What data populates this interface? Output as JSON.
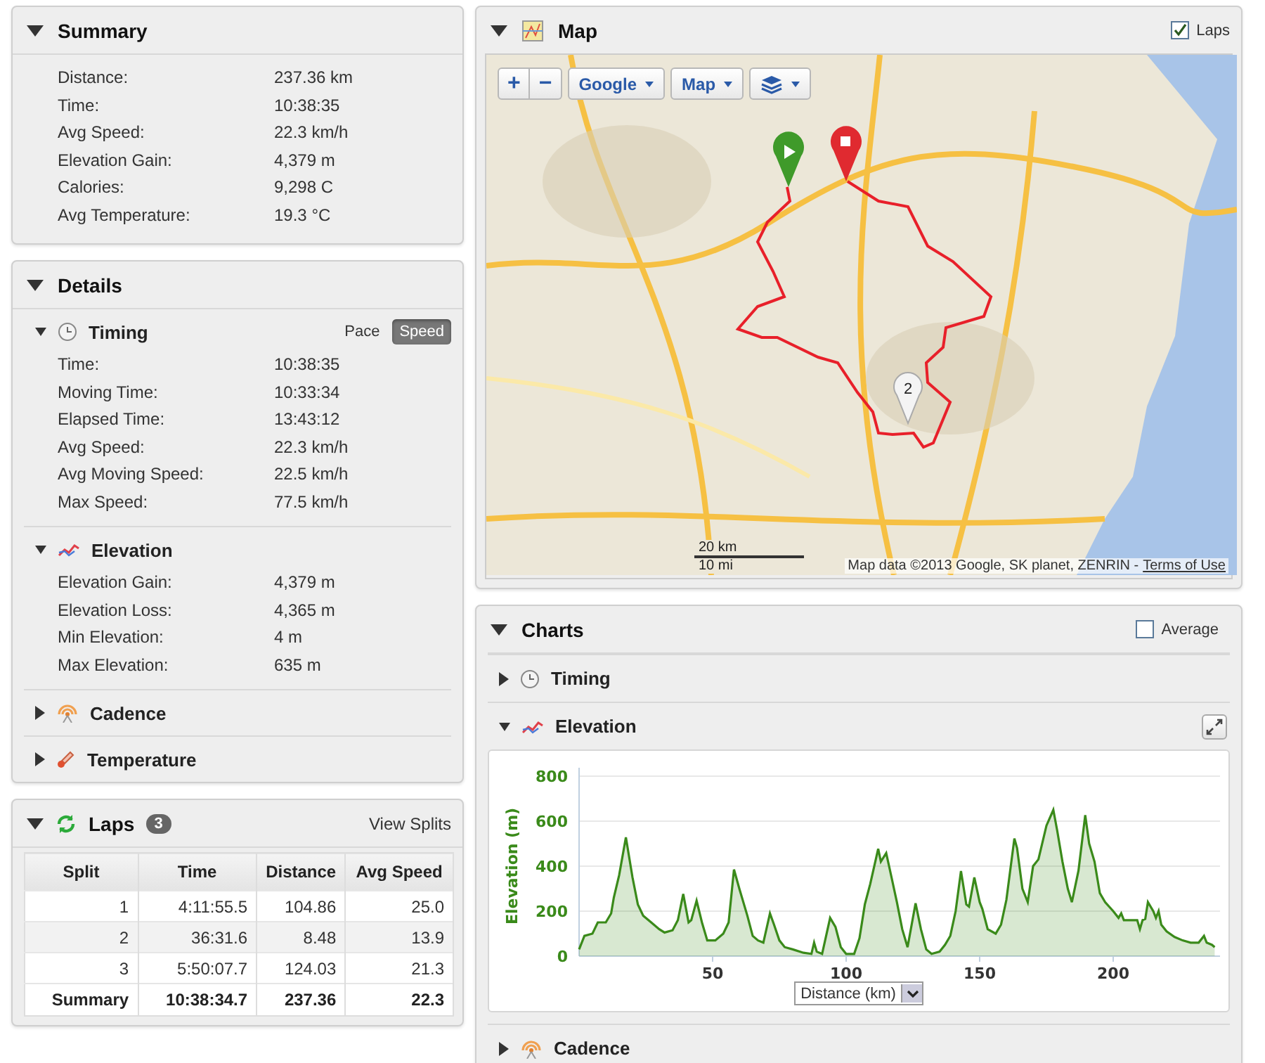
{
  "summary": {
    "title": "Summary",
    "expanded": true,
    "rows": [
      {
        "label": "Distance:",
        "value": "237.36 km"
      },
      {
        "label": "Time:",
        "value": "10:38:35"
      },
      {
        "label": "Avg Speed:",
        "value": "22.3 km/h"
      },
      {
        "label": "Elevation Gain:",
        "value": "4,379 m"
      },
      {
        "label": "Calories:",
        "value": "9,298 C"
      },
      {
        "label": "Avg Temperature:",
        "value": "19.3 °C"
      }
    ]
  },
  "details": {
    "title": "Details",
    "expanded": true,
    "sections": [
      {
        "kind": "timing",
        "title": "Timing",
        "expanded": true,
        "toggle": [
          {
            "label": "Pace",
            "selected": false
          },
          {
            "label": "Speed",
            "selected": true
          }
        ],
        "rows": [
          {
            "label": "Time:",
            "value": "10:38:35"
          },
          {
            "label": "Moving Time:",
            "value": "10:33:34"
          },
          {
            "label": "Elapsed Time:",
            "value": "13:43:12"
          },
          {
            "label": "Avg Speed:",
            "value": "22.3 km/h"
          },
          {
            "label": "Avg Moving Speed:",
            "value": "22.5 km/h"
          },
          {
            "label": "Max Speed:",
            "value": "77.5 km/h"
          }
        ]
      },
      {
        "kind": "elevation",
        "title": "Elevation",
        "expanded": true,
        "rows": [
          {
            "label": "Elevation Gain:",
            "value": "4,379 m"
          },
          {
            "label": "Elevation Loss:",
            "value": "4,365 m"
          },
          {
            "label": "Min Elevation:",
            "value": "4 m"
          },
          {
            "label": "Max Elevation:",
            "value": "635 m"
          }
        ]
      },
      {
        "kind": "cadence",
        "title": "Cadence",
        "expanded": false
      },
      {
        "kind": "temperature",
        "title": "Temperature",
        "expanded": false
      }
    ]
  },
  "laps": {
    "title": "Laps",
    "expanded": true,
    "count": "3",
    "link": "View Splits",
    "columns": [
      "Split",
      "Time",
      "Distance",
      "Avg Speed"
    ],
    "rows": [
      {
        "kind": "lap",
        "cells": [
          "1",
          "4:11:55.5",
          "104.86",
          "25.0"
        ]
      },
      {
        "kind": "lap",
        "cells": [
          "2",
          "36:31.6",
          "8.48",
          "13.9"
        ]
      },
      {
        "kind": "lap",
        "cells": [
          "3",
          "5:50:07.7",
          "124.03",
          "21.3"
        ]
      },
      {
        "kind": "summary",
        "cells": [
          "Summary",
          "10:38:34.7",
          "237.36",
          "22.3"
        ]
      }
    ]
  },
  "map": {
    "title": "Map",
    "expanded": true,
    "laps_checkbox": {
      "label": "Laps",
      "checked": true
    },
    "controls": {
      "zoom_in": "+",
      "zoom_out": "−",
      "provider": "Google",
      "type": "Map"
    },
    "scale": [
      "20 km",
      "10 mi"
    ],
    "attribution": "Map data ©2013 Google, SK planet, ZENRIN -",
    "terms_link": "Terms of Use",
    "lap_marker_label": "2"
  },
  "charts": {
    "title": "Charts",
    "expanded": true,
    "average_checkbox": {
      "label": "Average",
      "checked": false
    },
    "sections": [
      {
        "kind": "timing",
        "title": "Timing",
        "expanded": false
      },
      {
        "kind": "elevation",
        "title": "Elevation",
        "expanded": true,
        "x_axis_select": "Distance (km)",
        "chart_data": {
          "type": "area",
          "grid": true,
          "ylabel": "Elevation (m)",
          "xlim": [
            0,
            240
          ],
          "ylim": [
            0,
            800
          ],
          "xticks": [
            50,
            100,
            150,
            200
          ],
          "yticks": [
            0,
            200,
            400,
            600,
            800
          ],
          "x": [
            0,
            2,
            5,
            7,
            10,
            12,
            13,
            15,
            17.5,
            20,
            22,
            24,
            27,
            30,
            32,
            35,
            37,
            39,
            41,
            42,
            44,
            46,
            48,
            51,
            54,
            56,
            58,
            60,
            63,
            65,
            67,
            69,
            71.5,
            73,
            75,
            77,
            80,
            84,
            87,
            88,
            89,
            91,
            94,
            96,
            98,
            100,
            103,
            105,
            107,
            109,
            112,
            113,
            115,
            117,
            119,
            121,
            123,
            126,
            128,
            130,
            132,
            135,
            137,
            139,
            141,
            143,
            145,
            146,
            148,
            150,
            151,
            153,
            156,
            158,
            160,
            163,
            164,
            166,
            168,
            170,
            172,
            175,
            177.6,
            179,
            181,
            183,
            184.5,
            187,
            189.5,
            191,
            193,
            195,
            197,
            200,
            202,
            203,
            204,
            207,
            209,
            210,
            211,
            212,
            213,
            215,
            216,
            217,
            218,
            220,
            223,
            226,
            229,
            232,
            234,
            235,
            237,
            238
          ],
          "series": [
            {
              "color": "#3a8a1a",
              "values": [
                30,
                90,
                100,
                150,
                150,
                190,
                260,
                360,
                528,
                350,
                230,
                180,
                150,
                120,
                105,
                115,
                160,
                276,
                150,
                160,
                246,
                150,
                70,
                70,
                100,
                150,
                385,
                300,
                180,
                90,
                70,
                60,
                190,
                140,
                70,
                40,
                30,
                15,
                10,
                60,
                20,
                10,
                170,
                130,
                40,
                10,
                10,
                80,
                230,
                320,
                477,
                420,
                458,
                350,
                240,
                120,
                40,
                235,
                120,
                30,
                10,
                20,
                50,
                90,
                200,
                378,
                230,
                220,
                350,
                240,
                210,
                120,
                100,
                140,
                250,
                523,
                480,
                300,
                240,
                400,
                430,
                580,
                650,
                560,
                420,
                300,
                240,
                380,
                627,
                500,
                420,
                280,
                240,
                200,
                170,
                190,
                160,
                160,
                160,
                120,
                160,
                165,
                240,
                200,
                170,
                200,
                140,
                110,
                85,
                70,
                60,
                60,
                90,
                60,
                50,
                40
              ]
            }
          ]
        }
      },
      {
        "kind": "cadence",
        "title": "Cadence",
        "expanded": false
      }
    ]
  }
}
